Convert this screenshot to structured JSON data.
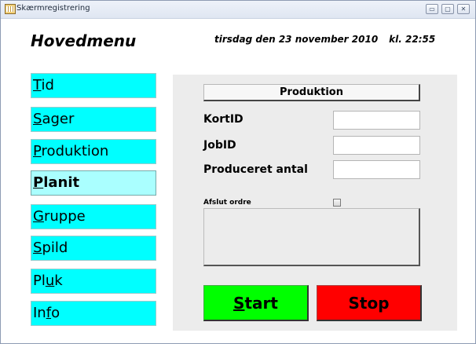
{
  "window": {
    "title": "Skærmregistrering",
    "controls": {
      "minimize": "▭",
      "maximize": "▢",
      "close": "✕"
    }
  },
  "header": {
    "title": "Hovedmenu",
    "date": "tirsdag den 23 november 2010",
    "time": "kl. 22:55"
  },
  "nav": {
    "items": [
      {
        "key": "tid",
        "accel": "T",
        "rest": "id",
        "active": false
      },
      {
        "key": "sager",
        "accel": "S",
        "rest": "ager",
        "active": false
      },
      {
        "key": "produktion",
        "accel": "P",
        "rest": "roduktion",
        "active": false
      },
      {
        "key": "planit",
        "accel": "P",
        "rest": "lanit",
        "active": true
      },
      {
        "key": "gruppe",
        "accel": "G",
        "rest": "ruppe",
        "active": false
      },
      {
        "key": "spild",
        "accel": "S",
        "rest": "pild",
        "active": false
      },
      {
        "key": "pluk",
        "pre": "Pl",
        "accel": "u",
        "rest": "k",
        "active": false
      },
      {
        "key": "info",
        "pre": "In",
        "accel": "f",
        "rest": "o",
        "active": false
      }
    ]
  },
  "panel": {
    "header": "Produktion",
    "fields": {
      "kortid": {
        "label": "KortID",
        "value": ""
      },
      "jobid": {
        "label": "JobID",
        "value": ""
      },
      "produced": {
        "label": "Produceret antal",
        "value": ""
      }
    },
    "close_order": {
      "label": "Afslut ordre",
      "checked": false
    },
    "start": {
      "accel": "S",
      "rest": "tart"
    },
    "stop": {
      "label": "Stop"
    }
  },
  "colors": {
    "nav_bg": "#00ffff",
    "nav_active_bg": "#aaffff",
    "start_bg": "#00ff00",
    "stop_bg": "#ff0000",
    "panel_bg": "#ececec"
  }
}
